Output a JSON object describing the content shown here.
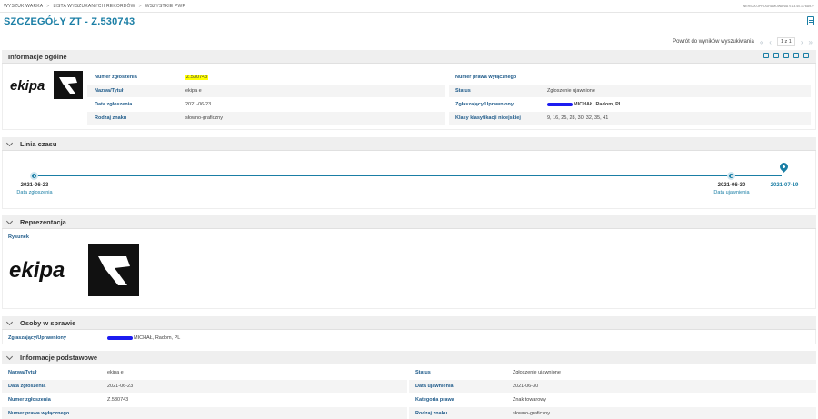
{
  "breadcrumbs": [
    "WYSZUKIWARKA",
    "LISTA WYSZUKANYCH REKORDÓW",
    "WSZYSTKIE PWP"
  ],
  "breadcrumb_sep": ">",
  "version": "Wersja oprogramowania v1.3.40.1.76a977",
  "title": "SZCZEGÓŁY ZT - Z.530743",
  "pager": {
    "back_label": "Powrót do wyników wyszukiwania",
    "count": "1 z 1"
  },
  "wordmark": "ekipa",
  "sections": {
    "general": {
      "title": "Informacje ogólne",
      "left": [
        {
          "label": "Numer zgłoszenia",
          "value": "Z.530743"
        },
        {
          "label": "Nazwa/Tytuł",
          "value": "ekipa e"
        },
        {
          "label": "Data zgłoszenia",
          "value": "2021-06-23"
        },
        {
          "label": "Rodzaj znaku",
          "value": "słowno-graficzny"
        }
      ],
      "right": [
        {
          "label": "Numer prawa wyłącznego",
          "value": ""
        },
        {
          "label": "Status",
          "value": "Zgłoszenie ujawnione"
        },
        {
          "label": "Zgłaszający/Uprawniony",
          "value": "MICHAŁ, Radom, PL"
        },
        {
          "label": "Klasy klasyfikacji nicejskiej",
          "value": "9, 16, 25, 28, 30, 32, 35, 41"
        }
      ]
    },
    "timeline": {
      "title": "Linia czasu",
      "events": [
        {
          "date": "2021-06-23",
          "caption": "Data zgłoszenia"
        },
        {
          "date": "2021-06-30",
          "caption": "Data ujawnienia"
        },
        {
          "date": "2021-07-19",
          "caption": ""
        }
      ]
    },
    "representation": {
      "title": "Reprezentacja",
      "label": "Rysunek"
    },
    "persons": {
      "title": "Osoby w sprawie",
      "label": "Zgłaszający/Uprawniony",
      "value": "MICHAŁ, Radom, PL"
    },
    "basic": {
      "title": "Informacje podstawowe",
      "left": [
        {
          "label": "Nazwa/Tytuł",
          "value": "ekipa e"
        },
        {
          "label": "Data zgłoszenia",
          "value": "2021-06-23"
        },
        {
          "label": "Numer zgłoszenia",
          "value": "Z.530743"
        },
        {
          "label": "Numer prawa wyłącznego",
          "value": ""
        }
      ],
      "right": [
        {
          "label": "Status",
          "value": "Zgłoszenie ujawnione"
        },
        {
          "label": "Data ujawnienia",
          "value": "2021-06-30"
        },
        {
          "label": "Kategoria prawa",
          "value": "Znak towarowy"
        },
        {
          "label": "Rodzaj znaku",
          "value": "słowno-graficzny"
        }
      ]
    }
  },
  "colors": {
    "accent": "#1a7ea5",
    "label": "#1f5b8a",
    "highlight": "#ffff00",
    "redaction": "#1c1cf0"
  }
}
